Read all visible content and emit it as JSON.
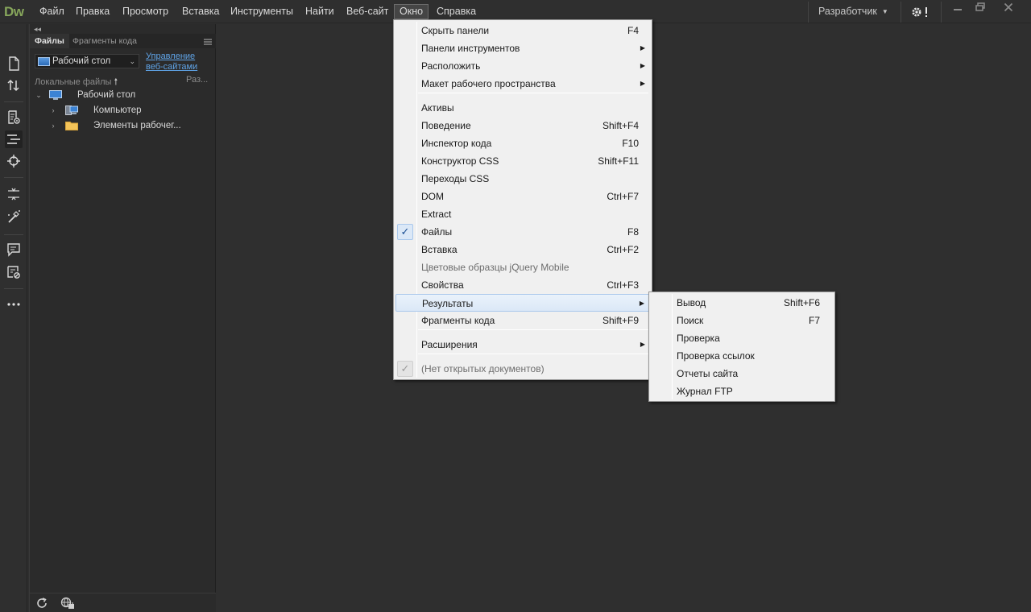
{
  "app": {
    "logo": "Dw"
  },
  "menubar": {
    "items": [
      "Файл",
      "Правка",
      "Просмотр",
      "Вставка",
      "Инструменты",
      "Найти",
      "Веб-сайт",
      "Окно",
      "Справка"
    ],
    "active": "Окно",
    "workspace": "Разработчик"
  },
  "panel": {
    "tabs": [
      "Файлы",
      "Фрагменты кода"
    ],
    "active_tab": "Файлы",
    "site": "Рабочий стол",
    "manage_link_line1": "Управление",
    "manage_link_line2": "веб-сайтами",
    "local_files_header": "Локальные файлы",
    "size_header": "Раз...",
    "tree": [
      {
        "label": "Рабочий стол",
        "icon": "desktop-icon",
        "expanded": true
      },
      {
        "label": "Компьютер",
        "icon": "computer-icon",
        "expanded": false
      },
      {
        "label": "Элементы рабочег...",
        "icon": "folder-icon",
        "expanded": false
      }
    ]
  },
  "window_menu": {
    "items": [
      {
        "label": "Скрыть панели",
        "shortcut": "F4"
      },
      {
        "label": "Панели инструментов",
        "submenu": true
      },
      {
        "label": "Расположить",
        "submenu": true
      },
      {
        "label": "Макет рабочего пространства",
        "submenu": true
      },
      {
        "label": "Активы"
      },
      {
        "label": "Поведение",
        "shortcut": "Shift+F4"
      },
      {
        "label": "Инспектор кода",
        "shortcut": "F10"
      },
      {
        "label": "Конструктор CSS",
        "shortcut": "Shift+F11"
      },
      {
        "label": "Переходы CSS"
      },
      {
        "label": "DOM",
        "shortcut": "Ctrl+F7"
      },
      {
        "label": "Extract"
      },
      {
        "label": "Файлы",
        "shortcut": "F8",
        "checked": true
      },
      {
        "label": "Вставка",
        "shortcut": "Ctrl+F2"
      },
      {
        "label": "Цветовые образцы jQuery Mobile",
        "disabled": true
      },
      {
        "label": "Свойства",
        "shortcut": "Ctrl+F3"
      },
      {
        "label": "Результаты",
        "submenu": true,
        "highlighted": true
      },
      {
        "label": "Фрагменты кода",
        "shortcut": "Shift+F9"
      },
      {
        "label": "Расширения",
        "submenu": true
      },
      {
        "label": "(Нет открытых документов)",
        "disabled": true,
        "checked": true
      }
    ]
  },
  "results_submenu": {
    "items": [
      {
        "label": "Вывод",
        "shortcut": "Shift+F6"
      },
      {
        "label": "Поиск",
        "shortcut": "F7"
      },
      {
        "label": "Проверка"
      },
      {
        "label": "Проверка ссылок"
      },
      {
        "label": "Отчеты сайта"
      },
      {
        "label": "Журнал FTP"
      }
    ]
  }
}
